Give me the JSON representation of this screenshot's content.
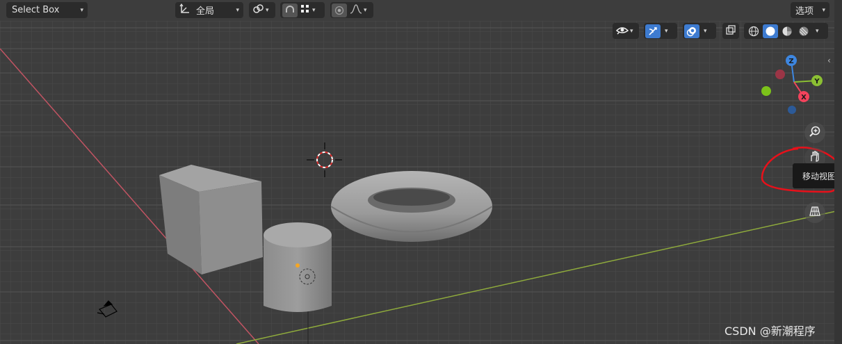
{
  "header": {
    "select_box_label": "Select Box",
    "transform_orientation": "全局",
    "options_label": "选项"
  },
  "icons": {
    "orientation": "transform-orientation-icon",
    "pivot": "pivot-point-icon",
    "snap": "snap-magnet-icon",
    "snap_target": "snap-grid-icon",
    "proportional": "proportional-editing-icon",
    "falloff": "falloff-curve-icon",
    "visibility": "eye-visibility-icon",
    "gizmo": "gizmo-icon",
    "overlay": "overlay-icon",
    "xray": "xray-toggle-icon",
    "shading": [
      "wireframe-shading-icon",
      "solid-shading-icon",
      "material-shading-icon",
      "rendered-shading-icon"
    ],
    "zoom": "zoom-view-icon",
    "move": "move-view-hand-icon",
    "camera": "camera-view-icon",
    "ortho": "ortho-grid-icon"
  },
  "gizmo": {
    "x": "X",
    "y": "Y",
    "z": "Z"
  },
  "tooltip": "移动视图",
  "watermark": "CSDN @新潮程序",
  "colors": {
    "viewport_bg": "#3d3d3d",
    "x_axis": "#c25463",
    "y_axis": "#8fab3c",
    "axis_x_gizmo": "#f2435c",
    "axis_y_gizmo": "#8bbf33",
    "axis_z_gizmo": "#3d86e0",
    "active_blue": "#3d7bd0",
    "annotation_red": "#e8101a"
  }
}
